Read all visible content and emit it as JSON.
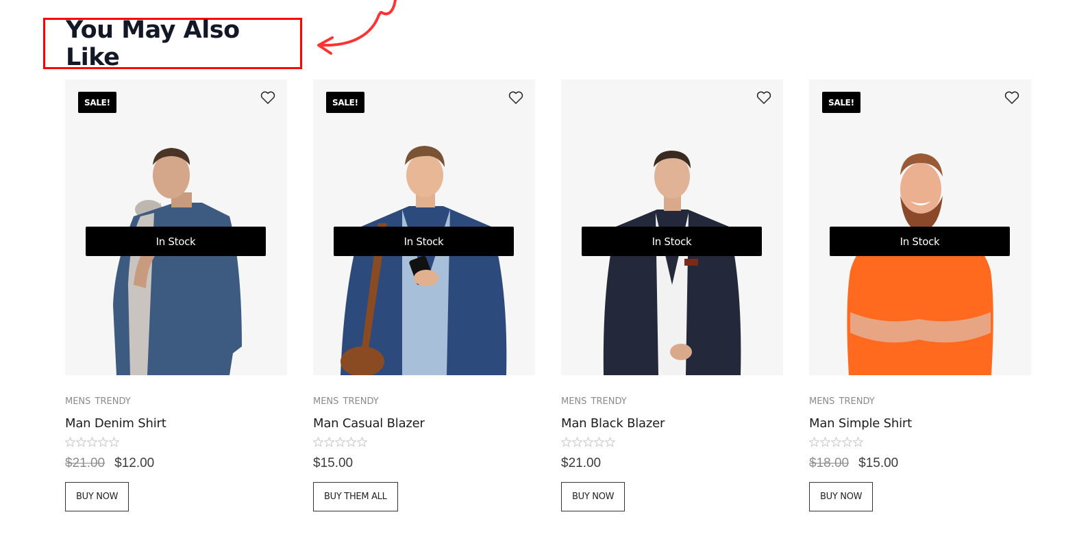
{
  "section": {
    "heading": "You May Also Like",
    "highlight_color": "#ff0000"
  },
  "products": [
    {
      "sale_badge": "SALE!",
      "on_sale": true,
      "stock_label": "In Stock",
      "category": "MENS TRENDY",
      "title": "Man Denim Shirt",
      "rating": 0,
      "rating_max": 5,
      "price_old": "$21.00",
      "price": "$12.00",
      "button_label": "BUY NOW",
      "image": "man-denim-shirt",
      "wishlist_icon": "heart-outline-icon"
    },
    {
      "sale_badge": "SALE!",
      "on_sale": true,
      "stock_label": "In Stock",
      "category": "MENS TRENDY",
      "title": "Man Casual Blazer",
      "rating": 0,
      "rating_max": 5,
      "price_old": null,
      "price": "$15.00",
      "button_label": "BUY THEM ALL",
      "image": "man-casual-blazer",
      "wishlist_icon": "heart-outline-icon"
    },
    {
      "sale_badge": null,
      "on_sale": false,
      "stock_label": "In Stock",
      "category": "MENS TRENDY",
      "title": "Man Black Blazer",
      "rating": 0,
      "rating_max": 5,
      "price_old": null,
      "price": "$21.00",
      "button_label": "BUY NOW",
      "image": "man-black-blazer",
      "wishlist_icon": "heart-outline-icon"
    },
    {
      "sale_badge": "SALE!",
      "on_sale": true,
      "stock_label": "In Stock",
      "category": "MENS TRENDY",
      "title": "Man Simple Shirt",
      "rating": 0,
      "rating_max": 5,
      "price_old": "$18.00",
      "price": "$15.00",
      "button_label": "BUY NOW",
      "image": "man-simple-shirt",
      "wishlist_icon": "heart-outline-icon"
    }
  ]
}
